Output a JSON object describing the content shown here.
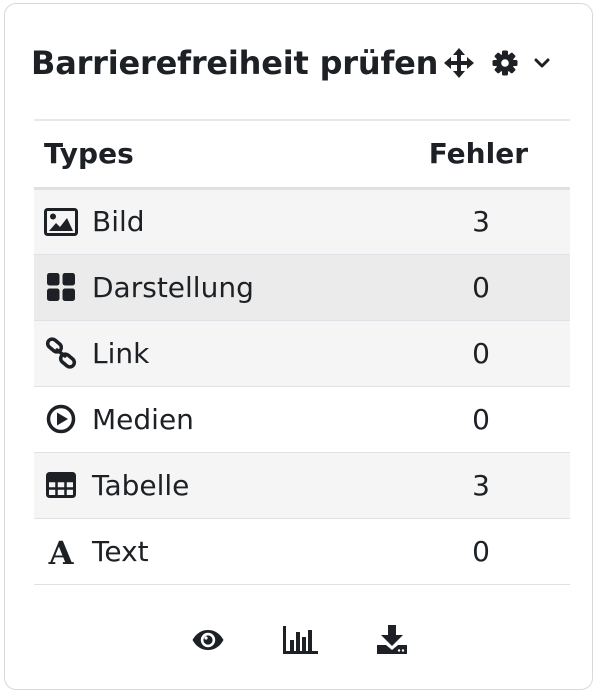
{
  "block": {
    "title": "Barrierefreiheit prüfen",
    "icons": {
      "move": "move-icon",
      "settings": "gear-icon",
      "menu": "chevron-down-icon"
    }
  },
  "table": {
    "headers": {
      "type": "Types",
      "errors": "Fehler"
    },
    "rows": [
      {
        "icon": "image-icon",
        "label": "Bild",
        "count": "3"
      },
      {
        "icon": "grid-icon",
        "label": "Darstellung",
        "count": "0"
      },
      {
        "icon": "link-icon",
        "label": "Link",
        "count": "0"
      },
      {
        "icon": "play-circle-icon",
        "label": "Medien",
        "count": "0"
      },
      {
        "icon": "table-icon",
        "label": "Tabelle",
        "count": "3"
      },
      {
        "icon": "font-icon",
        "label": "Text",
        "count": "0"
      }
    ]
  },
  "footer": {
    "icons": [
      "eye-icon",
      "bar-chart-icon",
      "download-icon"
    ]
  }
}
